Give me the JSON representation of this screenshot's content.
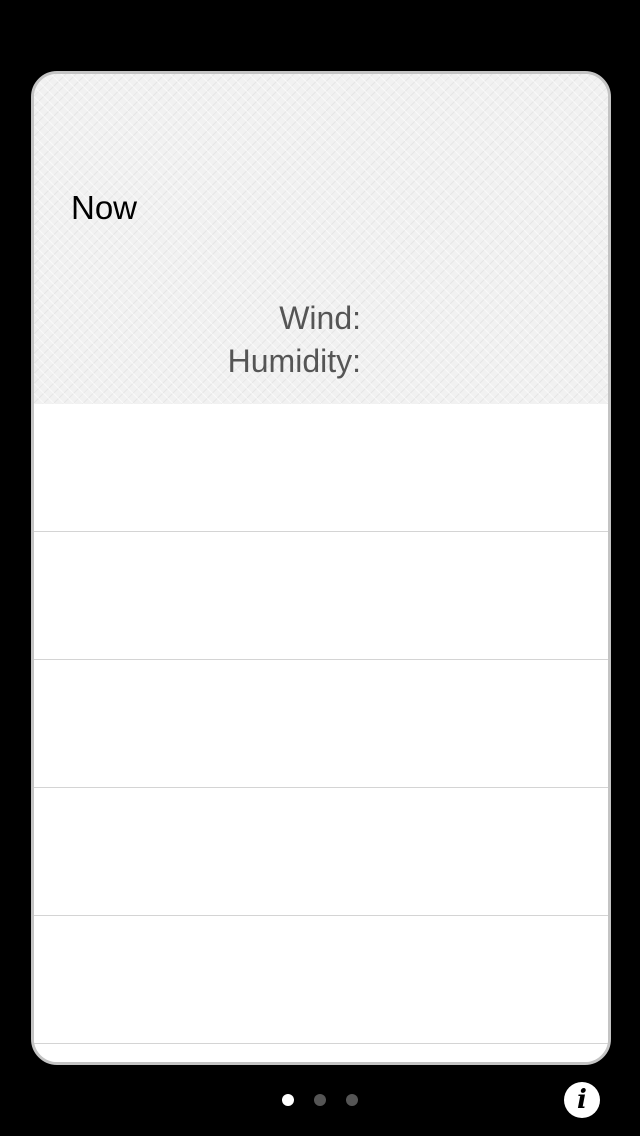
{
  "weather": {
    "now_label": "Now",
    "wind_label": "Wind:",
    "humidity_label": "Humidity:"
  },
  "forecast_rows": [
    "",
    "",
    "",
    "",
    "",
    ""
  ],
  "pager": {
    "page_count": 3,
    "current_page": 1
  },
  "info_button": {
    "icon": "info-icon",
    "glyph": "i"
  },
  "colors": {
    "background": "#000000",
    "card": "#ffffff",
    "header": "#f1f1f1",
    "label_text": "#555555"
  }
}
